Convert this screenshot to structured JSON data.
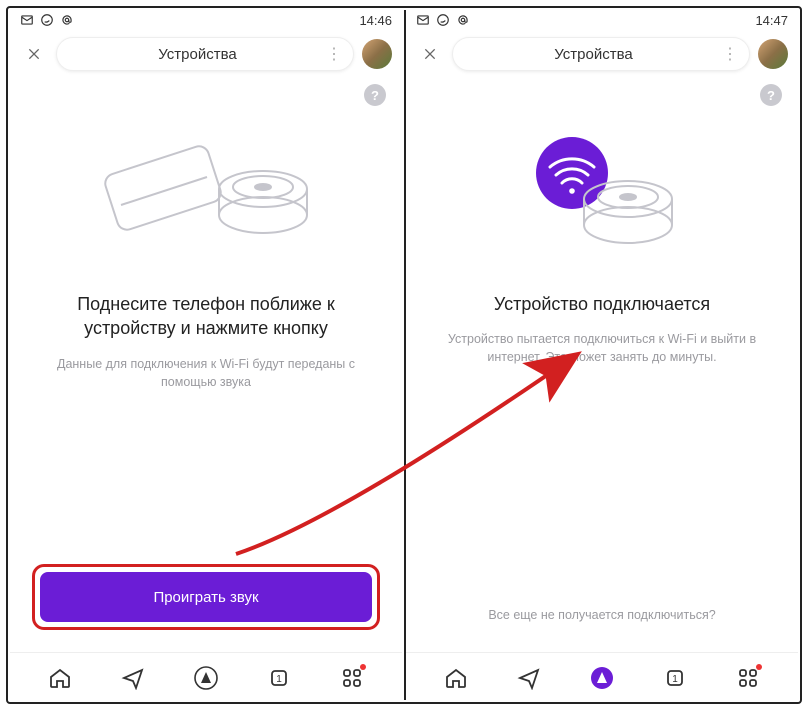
{
  "left": {
    "status_time": "14:46",
    "header_title": "Устройства",
    "help": "?",
    "heading": "Поднесите телефон поближе к устройству и нажмите кнопку",
    "subtext": "Данные для подключения к Wi-Fi будут переданы с помощью звука",
    "play_label": "Проиграть звук"
  },
  "right": {
    "status_time": "14:47",
    "header_title": "Устройства",
    "help": "?",
    "heading": "Устройство подключается",
    "subtext": "Устройство пытается подключиться к Wi-Fi и выйти в интернет. Это может занять до минуты.",
    "bottom_link": "Все еще не получается подключиться?"
  },
  "colors": {
    "accent": "#6b1dd6",
    "highlight": "#d22020"
  }
}
